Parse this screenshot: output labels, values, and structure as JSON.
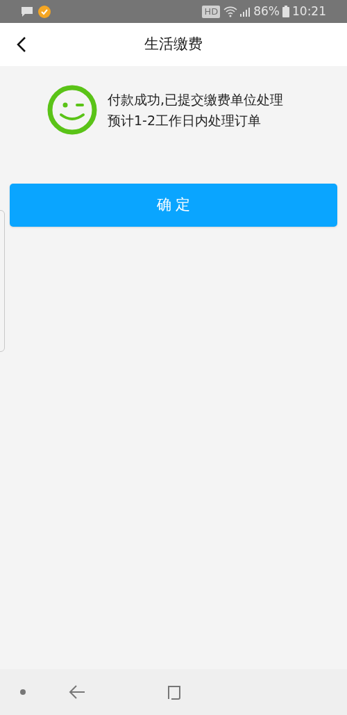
{
  "status_bar": {
    "battery": "86%",
    "time": "10:21",
    "hd_badge": "HD"
  },
  "header": {
    "title": "生活缴费"
  },
  "result": {
    "lines": [
      "付款成功,已提交缴费单位处理",
      "预计1-2工作日内处理订单"
    ]
  },
  "confirm_button": {
    "label": "确 定"
  }
}
